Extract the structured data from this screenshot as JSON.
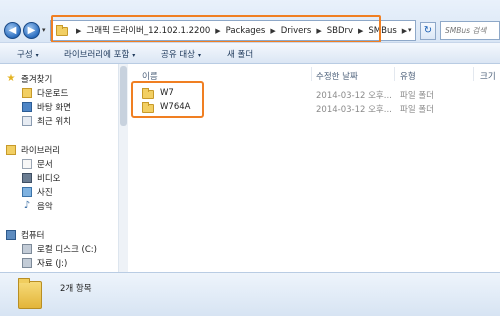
{
  "nav": {
    "back_glyph": "◀",
    "forward_glyph": "▶",
    "dropdown_glyph": "▾"
  },
  "address": {
    "crumbs": [
      "그래픽 드라이버_12.102.1.2200",
      "Packages",
      "Drivers",
      "SBDrv",
      "SMBus"
    ],
    "separator": "▶"
  },
  "search": {
    "placeholder": "SMBus 검색"
  },
  "toolbar": {
    "organize": "구성",
    "include_library": "라이브러리에 포함",
    "share_with": "공유 대상",
    "new_folder": "새 폴더"
  },
  "sidebar": {
    "favorites": "즐겨찾기",
    "downloads": "다운로드",
    "desktop": "바탕 화면",
    "recent": "최근 위치",
    "libraries": "라이브러리",
    "documents": "문서",
    "videos": "비디오",
    "pictures": "사진",
    "music": "음악",
    "computer": "컴퓨터",
    "local_disk": "로컬 디스크 (C:)",
    "drive_j": "자료 (J:)"
  },
  "columns": {
    "name": "이름",
    "date": "수정한 날짜",
    "type": "유형",
    "size": "크기"
  },
  "files": [
    {
      "name": "W7",
      "date": "2014-03-12 오후...",
      "type": "파일 폴더"
    },
    {
      "name": "W764A",
      "date": "2014-03-12 오후...",
      "type": "파일 폴더"
    }
  ],
  "status": {
    "item_count": "2개 항목"
  },
  "colors": {
    "highlight": "#f07f22",
    "folder": "#f2cf63",
    "chrome": "#dfe9f5"
  }
}
